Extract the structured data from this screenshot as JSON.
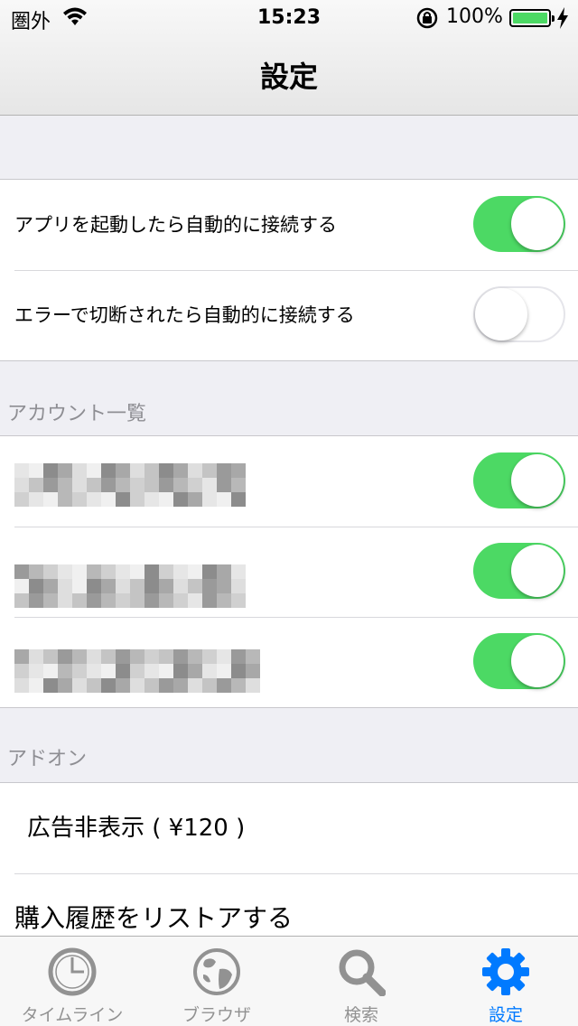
{
  "status_bar": {
    "carrier": "圏外",
    "time": "15:23",
    "battery_percent": "100%",
    "battery_level": 1.0,
    "icons": [
      "wifi-icon",
      "rotation-lock-icon",
      "battery-icon",
      "charging-bolt-icon"
    ]
  },
  "nav": {
    "title": "設定"
  },
  "connection_settings": {
    "rows": [
      {
        "label": "アプリを起動したら自動的に接続する",
        "toggle_on": true
      },
      {
        "label": "エラーで切断されたら自動的に接続する",
        "toggle_on": false
      }
    ]
  },
  "accounts": {
    "header": "アカウント一覧",
    "rows": [
      {
        "name": "",
        "redacted": true,
        "toggle_on": true
      },
      {
        "name": "",
        "redacted": true,
        "toggle_on": true
      },
      {
        "name": "",
        "redacted": true,
        "toggle_on": true
      }
    ]
  },
  "addons": {
    "header": "アドオン",
    "rows": [
      {
        "label": "広告非表示 ( ¥120 )"
      },
      {
        "label": "購入履歴をリストアする"
      }
    ]
  },
  "tabbar": {
    "tabs": [
      {
        "label": "タイムライン",
        "icon": "clock-icon",
        "active": false
      },
      {
        "label": "ブラウザ",
        "icon": "globe-icon",
        "active": false
      },
      {
        "label": "検索",
        "icon": "search-icon",
        "active": false
      },
      {
        "label": "設定",
        "icon": "gear-icon",
        "active": true
      }
    ]
  },
  "colors": {
    "toggle_on": "#4cd964",
    "tab_active": "#007aff",
    "tab_inactive": "#929292",
    "section_header": "#8e8e93",
    "background": "#efeff4"
  }
}
